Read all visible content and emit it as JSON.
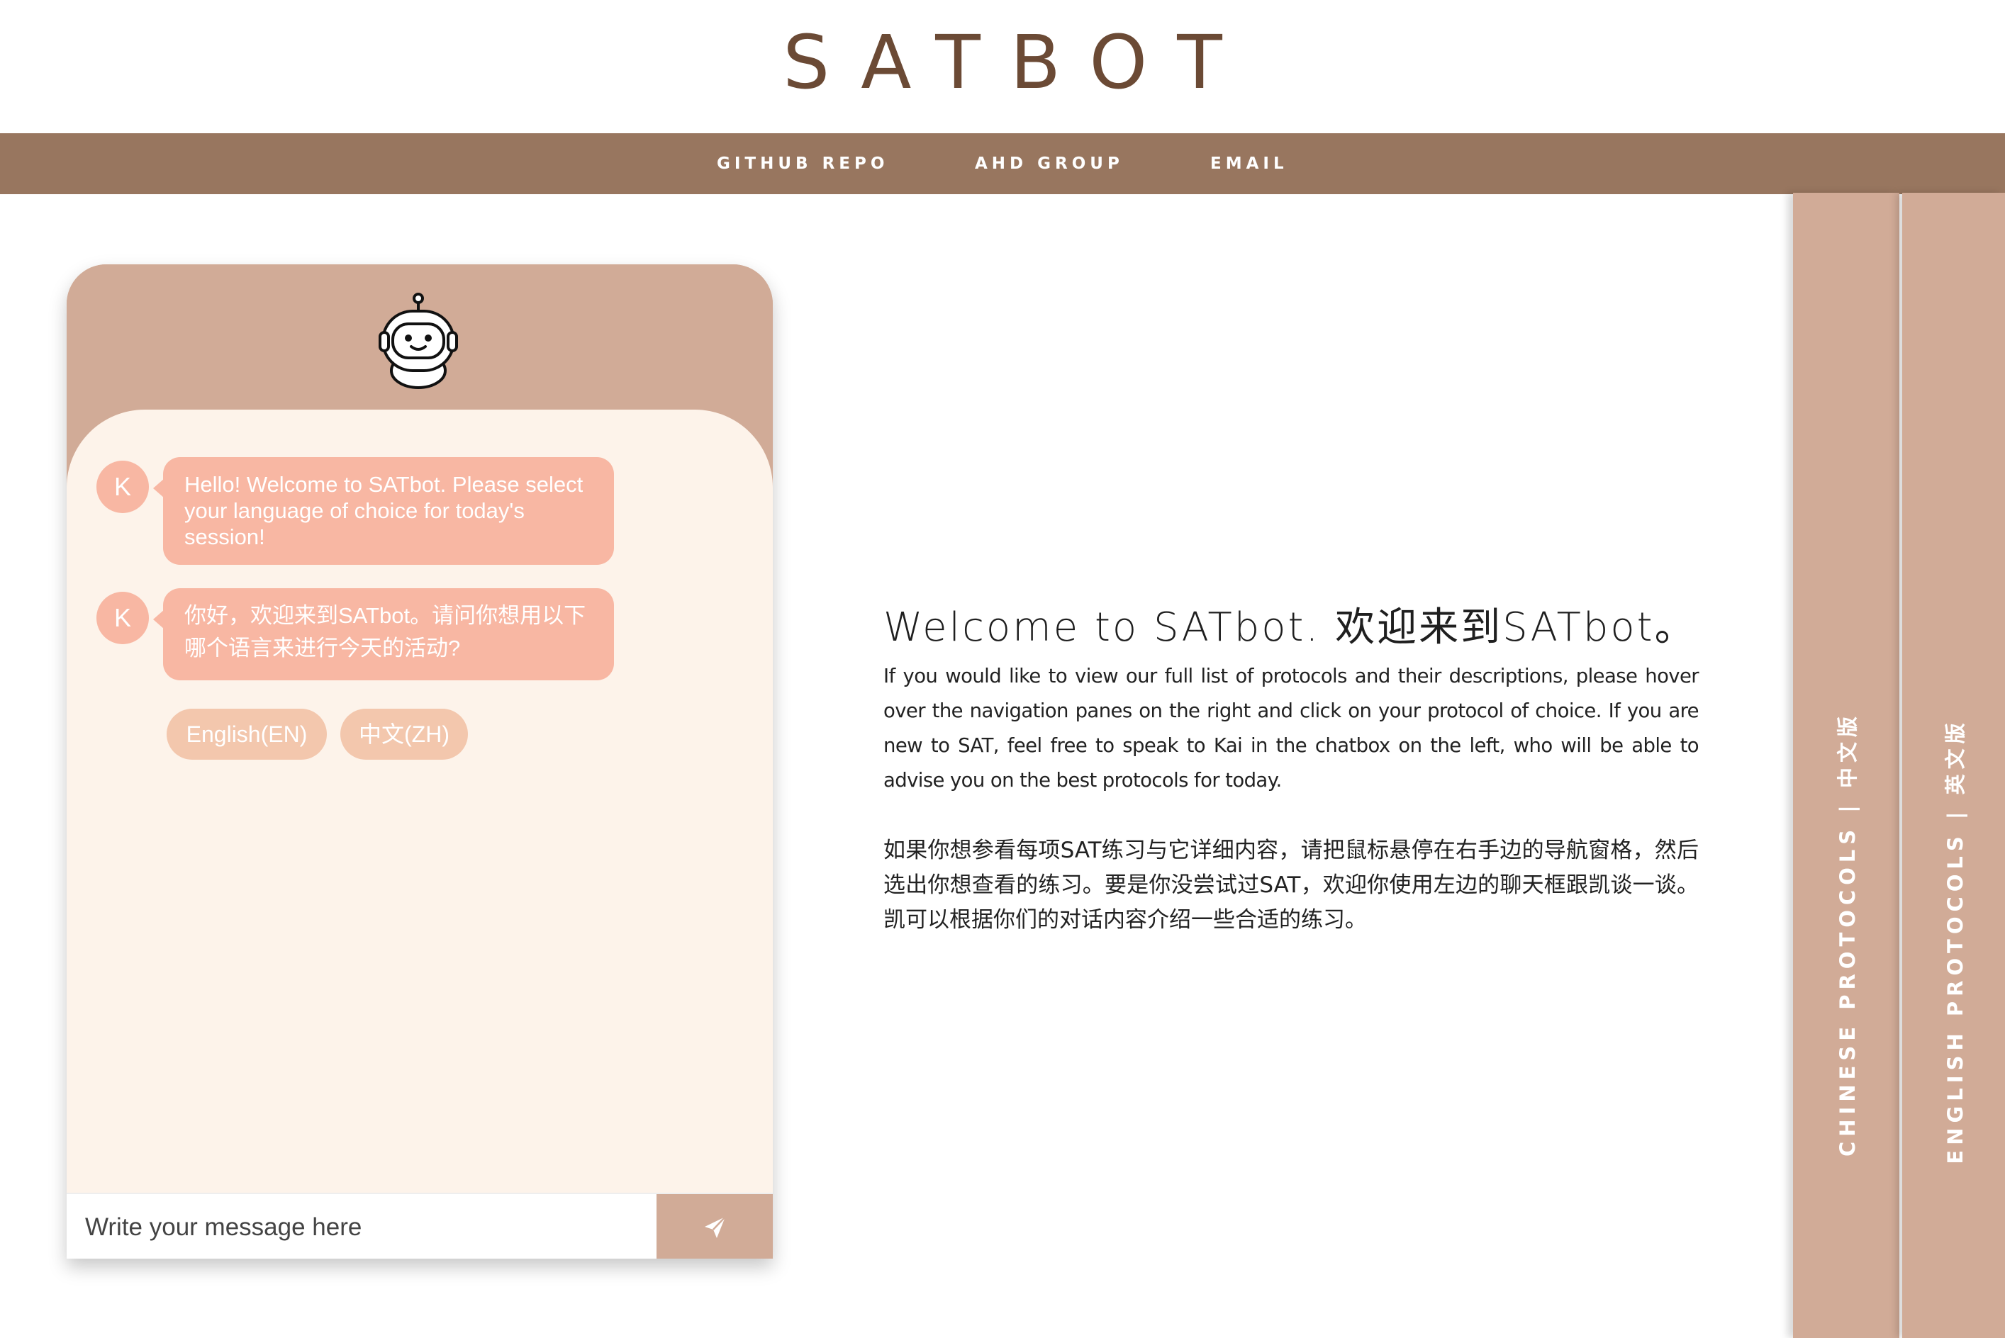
{
  "logo": "SATBOT",
  "nav": {
    "links": [
      "GITHUB REPO",
      "AHD GROUP",
      "EMAIL"
    ]
  },
  "side_tabs": {
    "chinese": "CHINESE PROTOCOLS | 中文版",
    "english": "ENGLISH PROTOCOLS | 英文版"
  },
  "chat": {
    "messages": [
      {
        "avatar": "K",
        "text": "Hello! Welcome to SATbot. Please select your language of choice for today's session!"
      },
      {
        "avatar": "K",
        "text": "你好，欢迎来到SATbot。请问你想用以下哪个语言来进行今天的活动?"
      }
    ],
    "choices": [
      "English(EN)",
      "中文(ZH)"
    ],
    "input_placeholder": "Write your message here",
    "send_icon": "paper-plane-icon",
    "bot_icon": "robot-icon"
  },
  "welcome": {
    "title": "Welcome to SATbot. 欢迎来到SATbot。",
    "paragraph_en": "If you would like to view our full list of protocols and their descriptions, please hover over the navigation panes on the right and click on your protocol of choice. If you are new to SAT, feel free to speak to Kai in the chatbox on the left, who will be able to advise you on the best protocols for today.",
    "paragraph_zh": "如果你想参看每项SAT练习与它详细内容，请把鼠标悬停在右手边的导航窗格，然后选出你想查看的练习。要是你没尝试过SAT，欢迎你使用左边的聊天框跟凯谈一谈。凯可以根据你们的对话内容介绍一些合适的练习。"
  },
  "colors": {
    "brown_text": "#6b4a35",
    "navbar": "#98765f",
    "tan": "#d1ab97",
    "bubble": "#f8b7a3",
    "choice": "#f3c7ad",
    "chat_bg": "#fdf3ea"
  }
}
